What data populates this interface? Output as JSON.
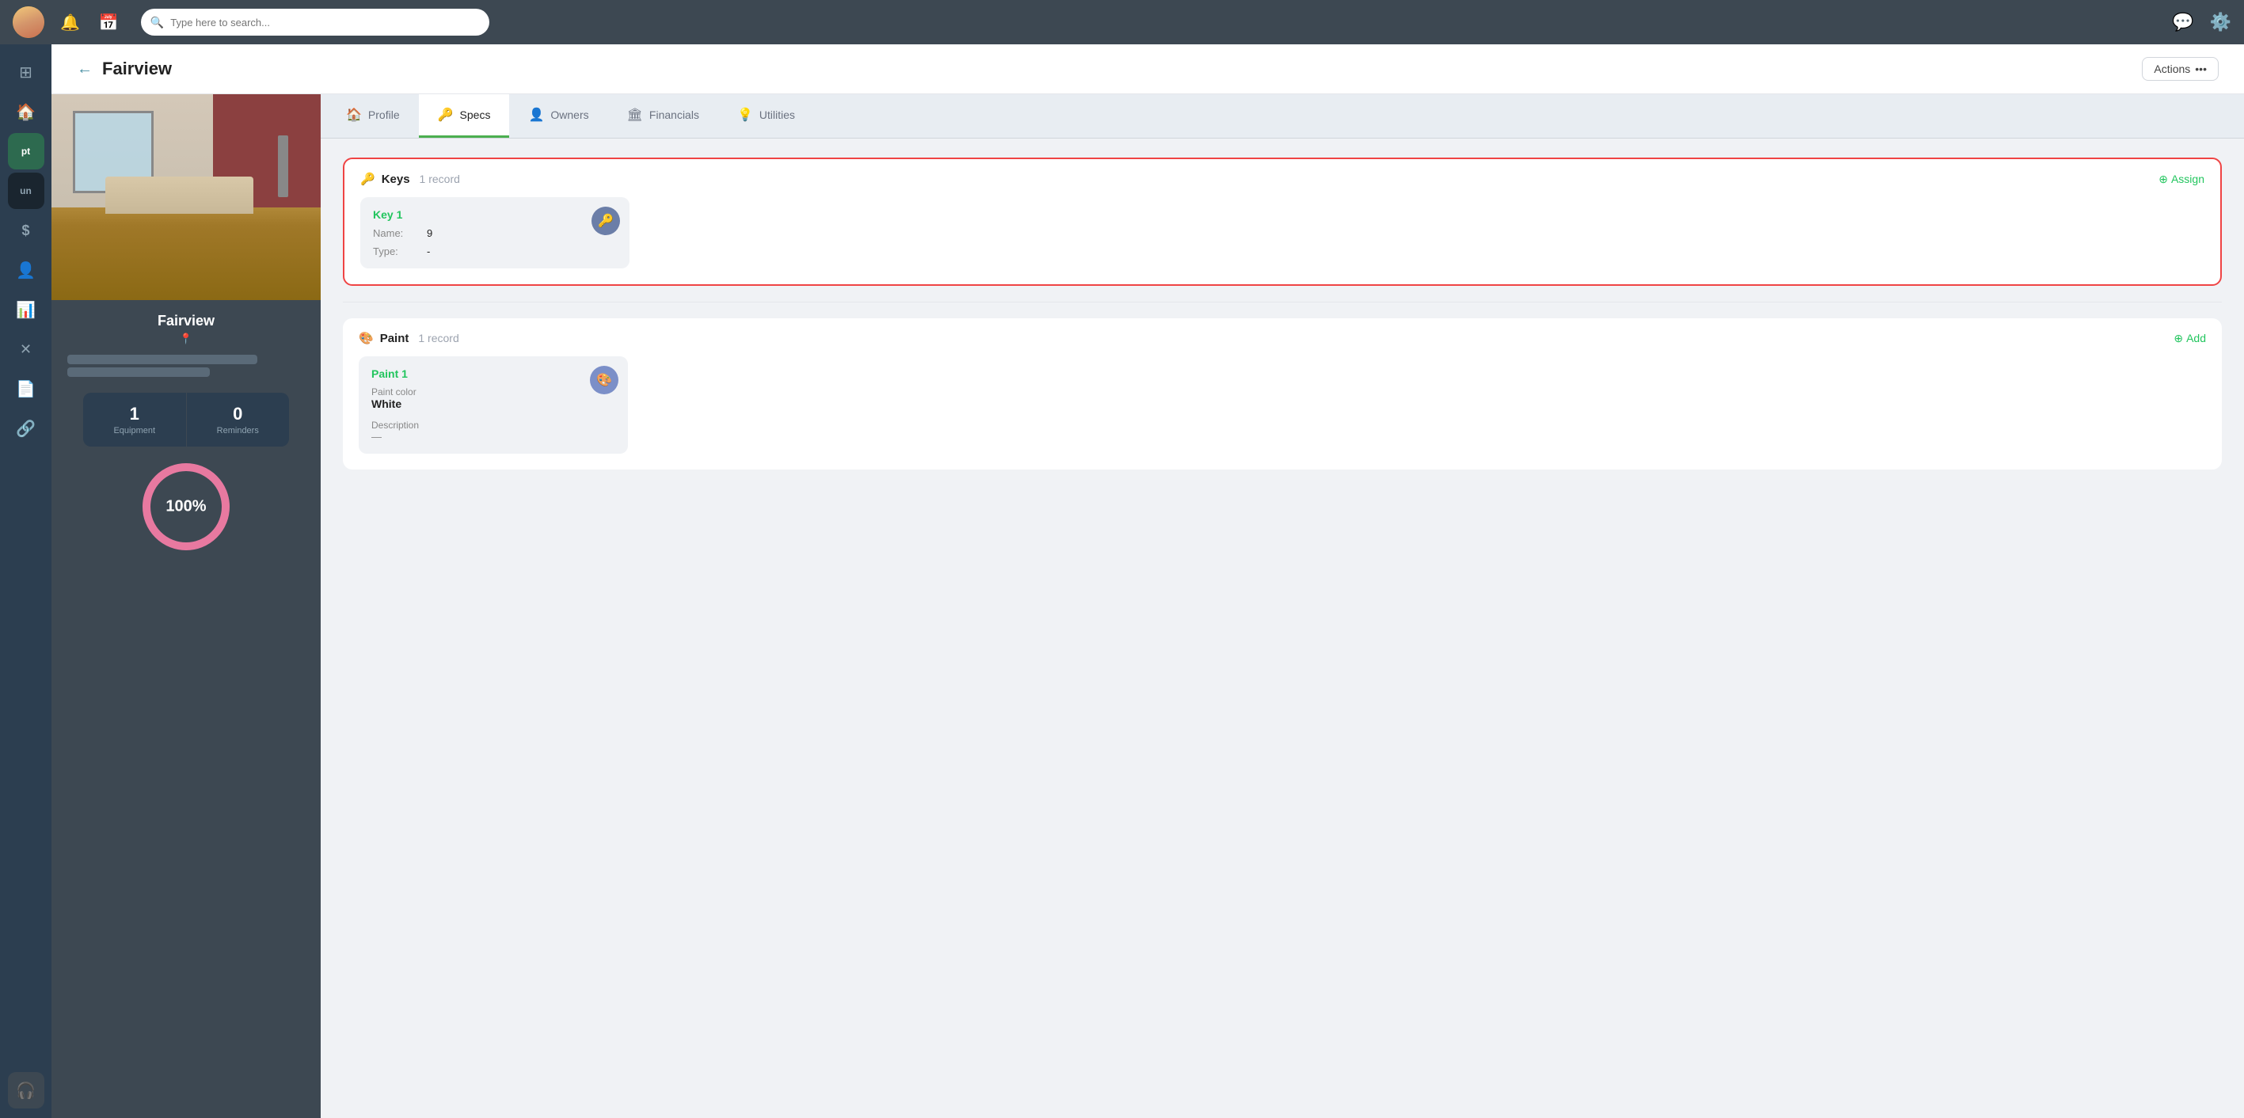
{
  "topNav": {
    "searchPlaceholder": "Type here to search...",
    "notifIcon": "🔔",
    "calendarIcon": "📅",
    "chatIcon": "💬",
    "settingsIcon": "⚙️"
  },
  "sidebar": {
    "items": [
      {
        "id": "grid",
        "icon": "⊞",
        "label": "Grid",
        "active": false
      },
      {
        "id": "home",
        "icon": "🏠",
        "label": "Home",
        "active": false
      },
      {
        "id": "pt",
        "label": "pt",
        "active": true,
        "type": "text-green"
      },
      {
        "id": "un",
        "label": "un",
        "active": false,
        "type": "text-dark"
      },
      {
        "id": "dollar",
        "icon": "$",
        "label": "Dollar"
      },
      {
        "id": "person",
        "icon": "👤",
        "label": "Person"
      },
      {
        "id": "chart",
        "icon": "📊",
        "label": "Chart"
      },
      {
        "id": "tools",
        "icon": "✕",
        "label": "Tools"
      },
      {
        "id": "doc",
        "icon": "📄",
        "label": "Document"
      },
      {
        "id": "link",
        "icon": "🔗",
        "label": "Link"
      },
      {
        "id": "headset",
        "icon": "🎧",
        "label": "Support",
        "accent": "yellow"
      }
    ]
  },
  "header": {
    "backLabel": "←",
    "title": "Fairview",
    "actionsLabel": "Actions",
    "actionsDotsLabel": "•••"
  },
  "leftPanel": {
    "propertyName": "Fairview",
    "locationIcon": "📍",
    "stats": [
      {
        "value": "1",
        "label": "Equipment"
      },
      {
        "value": "0",
        "label": "Reminders"
      }
    ],
    "progress": "100%"
  },
  "tabs": [
    {
      "id": "profile",
      "label": "Profile",
      "icon": "🏠",
      "active": false
    },
    {
      "id": "specs",
      "label": "Specs",
      "icon": "🔑",
      "active": true
    },
    {
      "id": "owners",
      "label": "Owners",
      "icon": "👤",
      "active": false
    },
    {
      "id": "financials",
      "label": "Financials",
      "icon": "🏛",
      "active": false
    },
    {
      "id": "utilities",
      "label": "Utilities",
      "icon": "💡",
      "active": false
    }
  ],
  "specs": {
    "keys": {
      "sectionTitle": "Keys",
      "recordCount": "1 record",
      "assignLabel": "Assign",
      "cards": [
        {
          "title": "Key 1",
          "fields": [
            {
              "label": "Name:",
              "value": "9"
            },
            {
              "label": "Type:",
              "value": "-"
            }
          ]
        }
      ]
    },
    "paint": {
      "sectionTitle": "Paint",
      "recordCount": "1 record",
      "addLabel": "Add",
      "cards": [
        {
          "title": "Paint 1",
          "colorLabel": "Paint color",
          "colorValue": "White",
          "descLabel": "Description",
          "descValue": "—"
        }
      ]
    }
  }
}
